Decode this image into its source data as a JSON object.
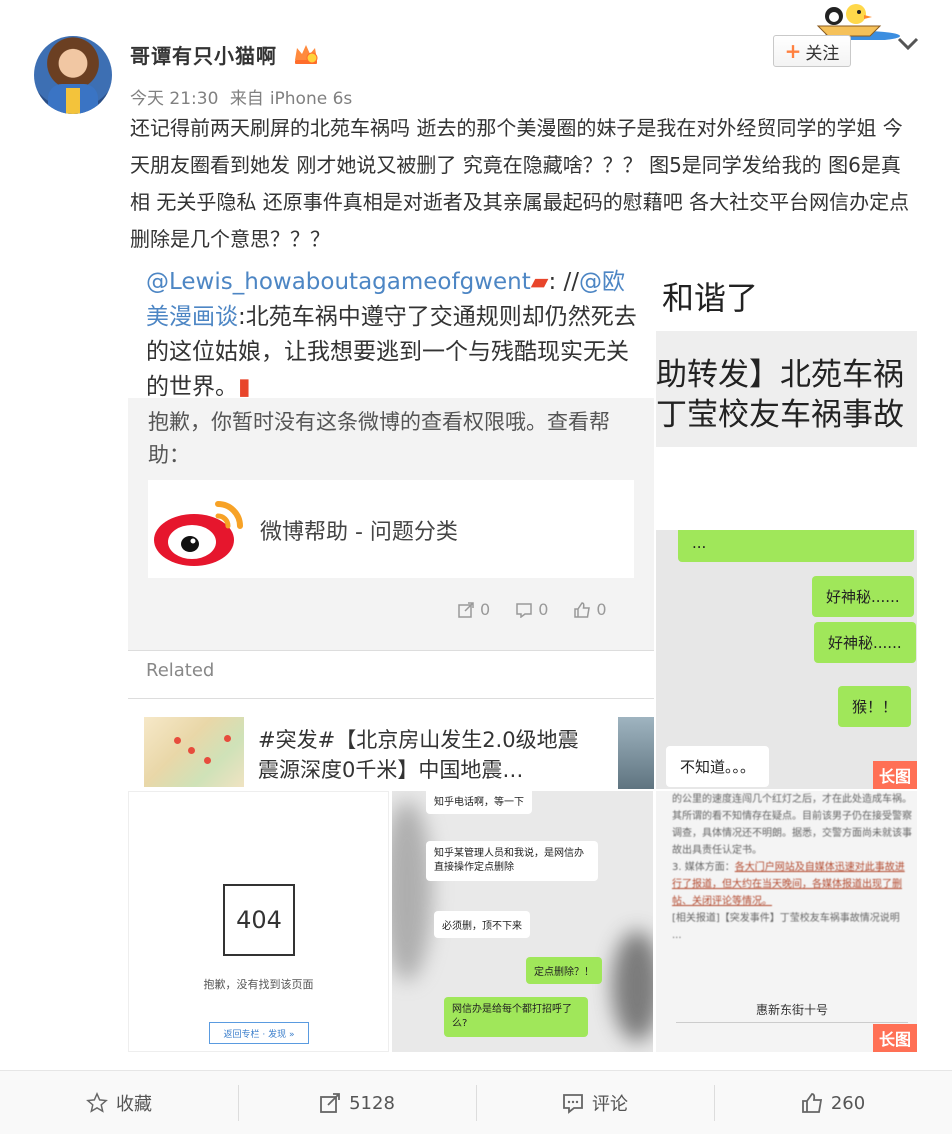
{
  "user": {
    "name": "哥谭有只小猫啊",
    "time": "今天 21:30",
    "source_prefix": "来自",
    "source": "iPhone 6s",
    "follow_label": "关注"
  },
  "post": {
    "text": "还记得前两天刷屏的北苑车祸吗 逝去的那个美漫圈的妹子是我在对外经贸同学的学姐 今天朋友圈看到她发 刚才她说又被删了 究竟在隐藏啥？？？ 图5是同学发给我的 图6是真相  无关乎隐私 还原事件真相是对逝者及其亲属最起码的慰藉吧 各大社交平台网信办定点删除是几个意思？？？"
  },
  "images": {
    "img1": {
      "quote_link1": "@Lewis_howaboutagameofgwent",
      "quote_sep": ": //",
      "quote_link2": "@欧美漫画谈",
      "quote_text": ":北苑车祸中遵守了交通规则却仍然死去的这位姑娘，让我想要逃到一个与残酷现实无关的世界。",
      "no_permission": "抱歉，你暂时没有这条微博的查看权限哦。查看帮助：",
      "card_label": "微博帮助 - 问题分类",
      "repost_count": "0",
      "comment_count": "0",
      "like_count": "0",
      "related_label": "Related",
      "news_text": "#突发#【北京房山发生2.0级地震 震源深度0千米】中国地震…"
    },
    "img2": {
      "line1": "和谐了",
      "line2": "助转发】北苑车祸",
      "line3": "丁莹校友车祸事故"
    },
    "img3": {
      "b1": "...",
      "b2": "好神秘......",
      "b3": "好神秘......",
      "b4": "猴！！",
      "b5": "不知道。。。",
      "badge": "长图"
    },
    "img4": {
      "code": "404",
      "msg": "抱歉，没有找到该页面",
      "btn": "返回专栏 · 发现 »"
    },
    "img5": {
      "b1": "知乎电话啊，等一下",
      "b2": "知乎某管理人员和我说，是网信办直接操作定点删除",
      "b3": "必须删，顶不下来",
      "b4": "定点删除？！",
      "b5": "网信办是给每个都打招呼了么?"
    },
    "img6": {
      "t1": "的公里的速度连闯几个红灯之后，才在此处造成车祸。其所谓的看不知情存在疑点。目前该男子仍在接受警察调查，具体情况还不明朗。据悉，交警方面尚未就该事故出具责任认定书。",
      "t2": "3. 媒体方面：",
      "t3": "各大门户网站及自媒体迅速对此事故进行了报道，但大约在当天晚间，各媒体报道出现了删帖、关闭评论等情况。",
      "t4": "[相关报道]【突发事件】丁莹校友车祸事故情况说明 ...",
      "t5": "惠新东街十号",
      "badge": "长图"
    }
  },
  "actions": {
    "favorite_label": "收藏",
    "repost_count": "5128",
    "comment_label": "评论",
    "like_count": "260"
  },
  "colors": {
    "link": "#4d86c4",
    "accent_orange": "#ff8140",
    "badge": "#ff7055",
    "chat_green": "#a0e75a"
  }
}
